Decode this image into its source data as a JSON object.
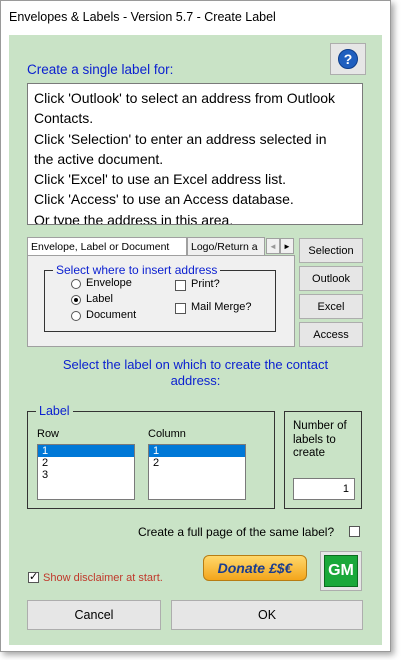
{
  "window": {
    "title": "Envelopes & Labels - Version 5.7 - Create Label"
  },
  "header": {
    "instruction": "Create a single label for:",
    "help_symbol": "?"
  },
  "address_box": {
    "lines": [
      "Click 'Outlook' to select an address from Outlook",
      "Contacts.",
      "Click 'Selection' to enter an address selected in",
      "the active document.",
      "Click 'Excel' to use an Excel address list.",
      "Click 'Access' to use an Access database.",
      "Or type the address in this area."
    ]
  },
  "tabs": {
    "items": [
      "Envelope, Label or Document",
      "Logo/Return a"
    ],
    "active": 0,
    "arrow_left": "◄",
    "arrow_right": "►"
  },
  "insert_group": {
    "legend": "Select where to insert address",
    "options": [
      {
        "label": "Envelope",
        "checked": false
      },
      {
        "label": "Label",
        "checked": true
      },
      {
        "label": "Document",
        "checked": false
      }
    ],
    "checkboxes": [
      {
        "label": "Print?",
        "checked": false
      },
      {
        "label": "Mail Merge?",
        "checked": false
      }
    ]
  },
  "source_buttons": [
    "Selection",
    "Outlook",
    "Excel",
    "Access"
  ],
  "prompt": {
    "line1": "Select the label on which to create the contact",
    "line2": "address:"
  },
  "label_group": {
    "legend": "Label",
    "row_header": "Row",
    "column_header": "Column",
    "rows": [
      "1",
      "2",
      "3"
    ],
    "columns": [
      "1",
      "2"
    ],
    "selected_row": "1",
    "selected_column": "1"
  },
  "number_box": {
    "label_line1": "Number of",
    "label_line2": "labels to",
    "label_line3": "create",
    "value": "1"
  },
  "full_page": {
    "label": "Create a full page of the same label?",
    "checked": false
  },
  "disclaimer": {
    "label": "Show disclaimer at start.",
    "checked": true
  },
  "donate": {
    "label": "Donate £$€"
  },
  "gm_logo": {
    "text": "GM"
  },
  "footer": {
    "cancel_label": "Cancel",
    "ok_label": "OK"
  },
  "colors": {
    "client_bg": "#c9e3c6",
    "accent_blue": "#0a1fd0",
    "selection": "#0078d7",
    "disclaimer_text": "#c0392b"
  }
}
